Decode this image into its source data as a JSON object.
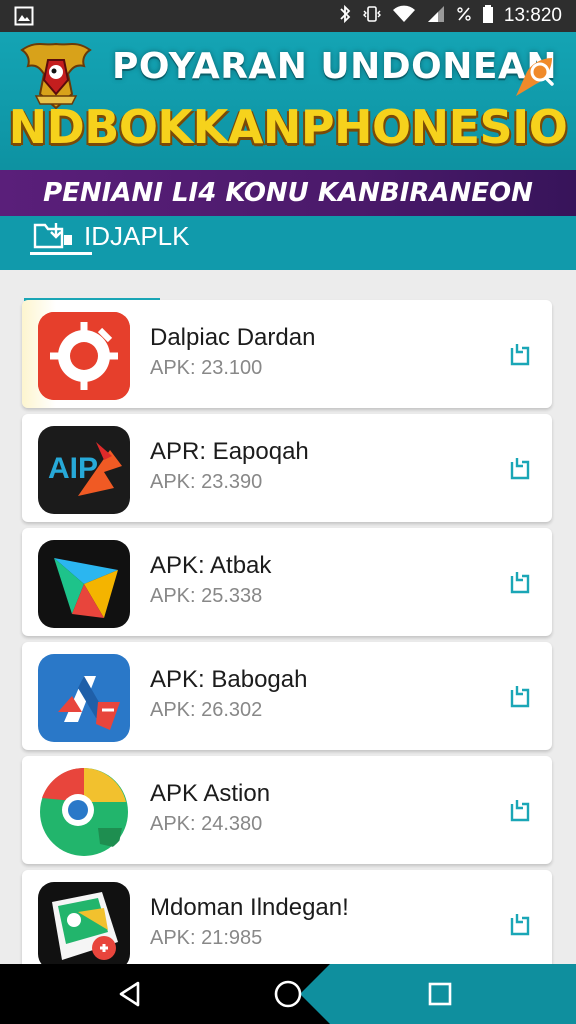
{
  "status_bar": {
    "time": "13:820",
    "icons": [
      "gallery-icon",
      "bluetooth-icon",
      "vibrate-icon",
      "wifi-icon",
      "signal-icon",
      "battery-icon"
    ]
  },
  "banner": {
    "line1": "POYARAN UNDONEAN",
    "line2": "NDBOKKANPHONESIO",
    "line3": "PENIANI LI4 KONU KANBIRANEON"
  },
  "tab": {
    "label": "IDJAPLK"
  },
  "apps": [
    {
      "title": "Dalpiac Dardan",
      "size": "APK: 23.100"
    },
    {
      "title": "APR: Eapoqah",
      "size": "APK: 23.390"
    },
    {
      "title": "APK: Atbak",
      "size": "APK: 25.338"
    },
    {
      "title": "APK: Babogah",
      "size": "APK: 26.302"
    },
    {
      "title": "APK Astion",
      "size": "APK: 24.380"
    },
    {
      "title": "Mdoman Ilndegan!",
      "size": "APK: 21:985"
    }
  ],
  "colors": {
    "accent": "#119aab",
    "banner_ribbon": "#4b1a6b",
    "banner_title_yellow": "#f6d21c",
    "download_icon": "#1aa6b6"
  }
}
